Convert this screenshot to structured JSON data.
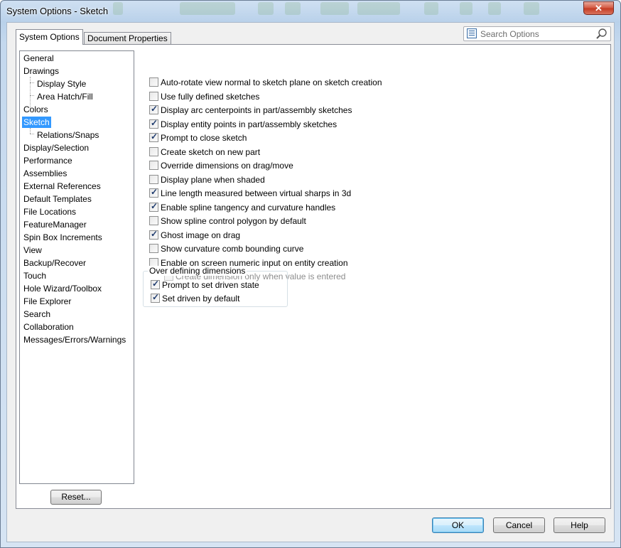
{
  "window": {
    "title": "System Options - Sketch",
    "close_glyph": "✕"
  },
  "tabs": [
    {
      "label": "System Options",
      "active": true
    },
    {
      "label": "Document Properties",
      "active": false
    }
  ],
  "search": {
    "placeholder": "Search Options"
  },
  "tree": {
    "items": [
      {
        "label": "General",
        "level": 0
      },
      {
        "label": "Drawings",
        "level": 0
      },
      {
        "label": "Display Style",
        "level": 1
      },
      {
        "label": "Area Hatch/Fill",
        "level": 1
      },
      {
        "label": "Colors",
        "level": 0
      },
      {
        "label": "Sketch",
        "level": 0,
        "selected": true
      },
      {
        "label": "Relations/Snaps",
        "level": 1
      },
      {
        "label": "Display/Selection",
        "level": 0
      },
      {
        "label": "Performance",
        "level": 0
      },
      {
        "label": "Assemblies",
        "level": 0
      },
      {
        "label": "External References",
        "level": 0
      },
      {
        "label": "Default Templates",
        "level": 0
      },
      {
        "label": "File Locations",
        "level": 0
      },
      {
        "label": "FeatureManager",
        "level": 0
      },
      {
        "label": "Spin Box Increments",
        "level": 0
      },
      {
        "label": "View",
        "level": 0
      },
      {
        "label": "Backup/Recover",
        "level": 0
      },
      {
        "label": "Touch",
        "level": 0
      },
      {
        "label": "Hole Wizard/Toolbox",
        "level": 0
      },
      {
        "label": "File Explorer",
        "level": 0
      },
      {
        "label": "Search",
        "level": 0
      },
      {
        "label": "Collaboration",
        "level": 0
      },
      {
        "label": "Messages/Errors/Warnings",
        "level": 0
      }
    ]
  },
  "reset_label": "Reset...",
  "options": [
    {
      "label": "Auto-rotate view normal to sketch plane on sketch creation",
      "checked": false
    },
    {
      "label": "Use fully defined sketches",
      "checked": false
    },
    {
      "label": "Display arc centerpoints in part/assembly sketches",
      "checked": true
    },
    {
      "label": "Display entity points in part/assembly sketches",
      "checked": true
    },
    {
      "label": "Prompt to close sketch",
      "checked": true
    },
    {
      "label": "Create sketch on new part",
      "checked": false
    },
    {
      "label": "Override dimensions on drag/move",
      "checked": false
    },
    {
      "label": "Display plane when shaded",
      "checked": false
    },
    {
      "label": "Line length measured between virtual sharps in 3d",
      "checked": true
    },
    {
      "label": "Enable spline tangency and curvature handles",
      "checked": true
    },
    {
      "label": "Show spline control polygon by default",
      "checked": false
    },
    {
      "label": "Ghost image on drag",
      "checked": true
    },
    {
      "label": "Show curvature comb bounding curve",
      "checked": false
    },
    {
      "label": "Enable on screen numeric input on entity creation",
      "checked": false
    },
    {
      "label": "Create dimension only when value is entered",
      "checked": false,
      "disabled": true,
      "indent": true
    }
  ],
  "over_defining": {
    "title": "Over defining dimensions",
    "options": [
      {
        "label": "Prompt to set driven state",
        "checked": true
      },
      {
        "label": "Set driven by default",
        "checked": true
      }
    ]
  },
  "buttons": {
    "ok": "OK",
    "cancel": "Cancel",
    "help": "Help"
  },
  "check_glyph": "✓"
}
